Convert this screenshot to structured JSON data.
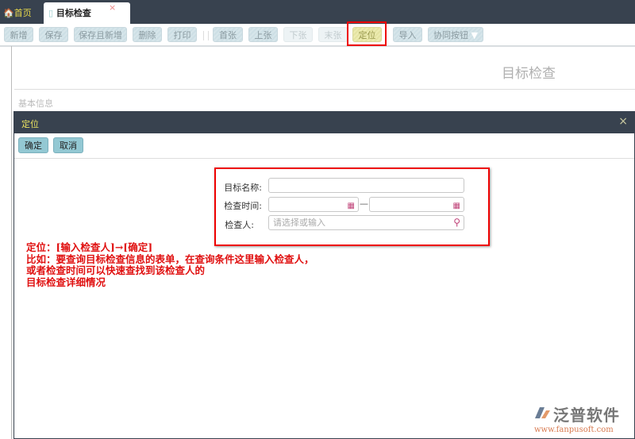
{
  "tabs": {
    "home": "首页",
    "active": "目标检查",
    "close": "×"
  },
  "toolbar": [
    "新增",
    "保存",
    "保存且新增",
    "删除",
    "打印",
    "首张",
    "上张",
    "下张",
    "末张",
    "定位",
    "导入",
    "协同按钮"
  ],
  "form": {
    "title": "目标检查",
    "section": "基本信息"
  },
  "dialog": {
    "title": "定位",
    "close": "×",
    "ok": "确定",
    "cancel": "取消",
    "fields": {
      "name_label": "目标名称:",
      "time_label": "检查时间:",
      "dash": "—",
      "person_label": "检查人:",
      "person_placeholder": "请选择或输入"
    }
  },
  "note": [
    "定位：[输入检查人]→[确定]",
    "比如：要查询目标检查信息的表单，在查询条件这里输入检查人，",
    "或者检查时间可以快速查找到该检查人的",
    "目标检查详细情况"
  ],
  "logo": {
    "name": "泛普软件",
    "url": "www.fanpusoft.com"
  }
}
